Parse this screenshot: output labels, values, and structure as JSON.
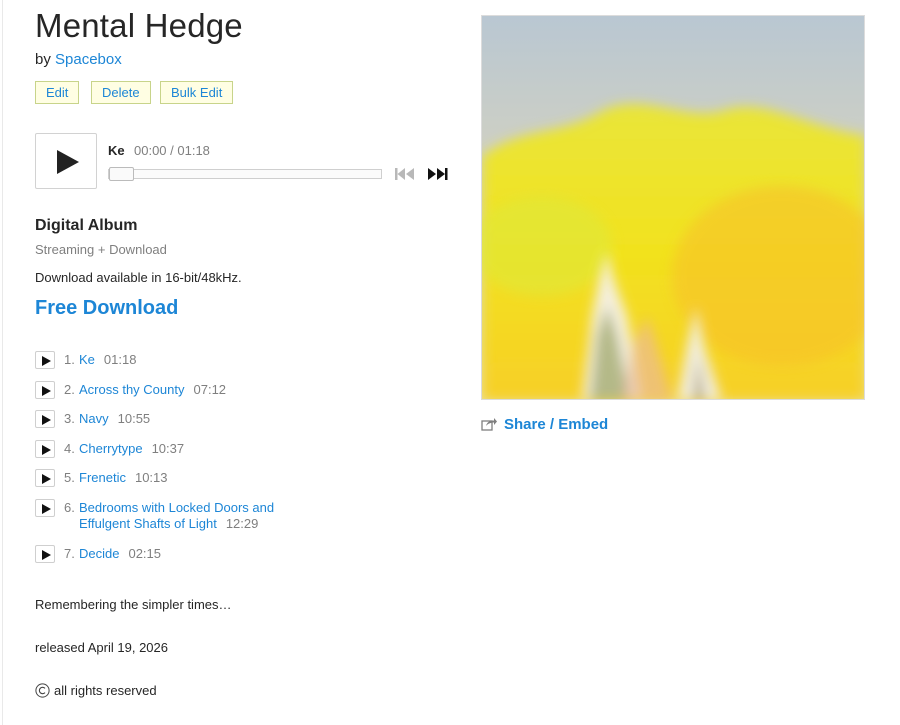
{
  "album": {
    "title": "Mental Hedge",
    "by_prefix": "by",
    "artist": "Spacebox"
  },
  "admin": {
    "edit_label": "Edit",
    "delete_label": "Delete",
    "bulk_edit_label": "Bulk Edit"
  },
  "player": {
    "current_track": "Ke",
    "time": "00:00 / 01:18",
    "progress": 0
  },
  "purchase": {
    "format": "Digital Album",
    "subtitle": "Streaming + Download",
    "availability": "Download available in 16-bit/48kHz.",
    "free_download_label": "Free Download"
  },
  "tracks": [
    {
      "num": "1.",
      "title": "Ke",
      "duration": "01:18"
    },
    {
      "num": "2.",
      "title": "Across thy County",
      "duration": "07:12"
    },
    {
      "num": "3.",
      "title": "Navy",
      "duration": "10:55"
    },
    {
      "num": "4.",
      "title": "Cherrytype",
      "duration": "10:37"
    },
    {
      "num": "5.",
      "title": "Frenetic",
      "duration": "10:13"
    },
    {
      "num": "6.",
      "title_line1": "Bedrooms with Locked Doors and",
      "title_line2": "Effulgent Shafts of Light",
      "duration": "12:29"
    },
    {
      "num": "7.",
      "title": "Decide",
      "duration": "02:15"
    }
  ],
  "about": "Remembering the simpler times…",
  "released": "released April 19, 2026",
  "rights": "all rights reserved",
  "share_label": "Share / Embed",
  "colors": {
    "link": "#1d86d6",
    "text": "#262626",
    "muted": "#7f7f7f",
    "button_bg": "#fffee3",
    "button_border": "#c8d48a"
  },
  "icons": {
    "play": "play-icon",
    "prev": "skip-previous-icon",
    "next": "skip-next-icon",
    "share": "share-icon",
    "copyright": "copyright-icon"
  }
}
